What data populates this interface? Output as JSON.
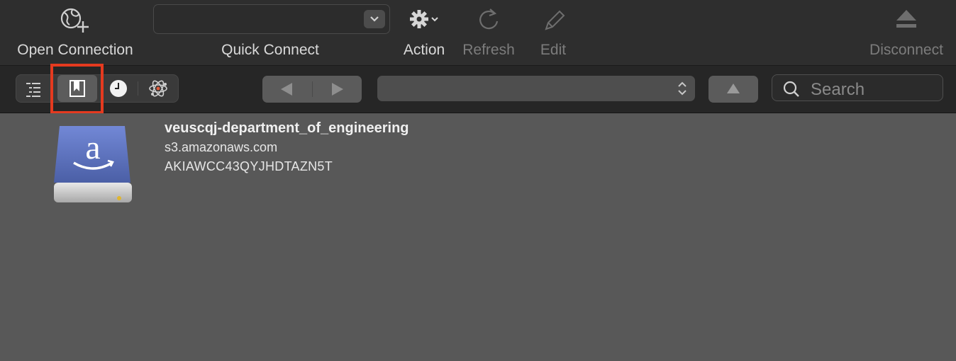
{
  "toolbar": {
    "open_connection": "Open Connection",
    "quick_connect": "Quick Connect",
    "action": "Action",
    "refresh": "Refresh",
    "edit": "Edit",
    "disconnect": "Disconnect"
  },
  "browser_bar": {
    "search_placeholder": "Search",
    "views": [
      "outline-view",
      "bookmarks-view",
      "history-view",
      "bonjour-view"
    ],
    "active_view": "bookmarks-view"
  },
  "bookmark": {
    "name": "veuscqj-department_of_engineering",
    "hostname": "s3.amazonaws.com",
    "username": "AKIAWCC43QYJHDTAZN5T"
  },
  "colors": {
    "highlight": "#e53a1f",
    "drive_blue": "#5c74c4"
  }
}
